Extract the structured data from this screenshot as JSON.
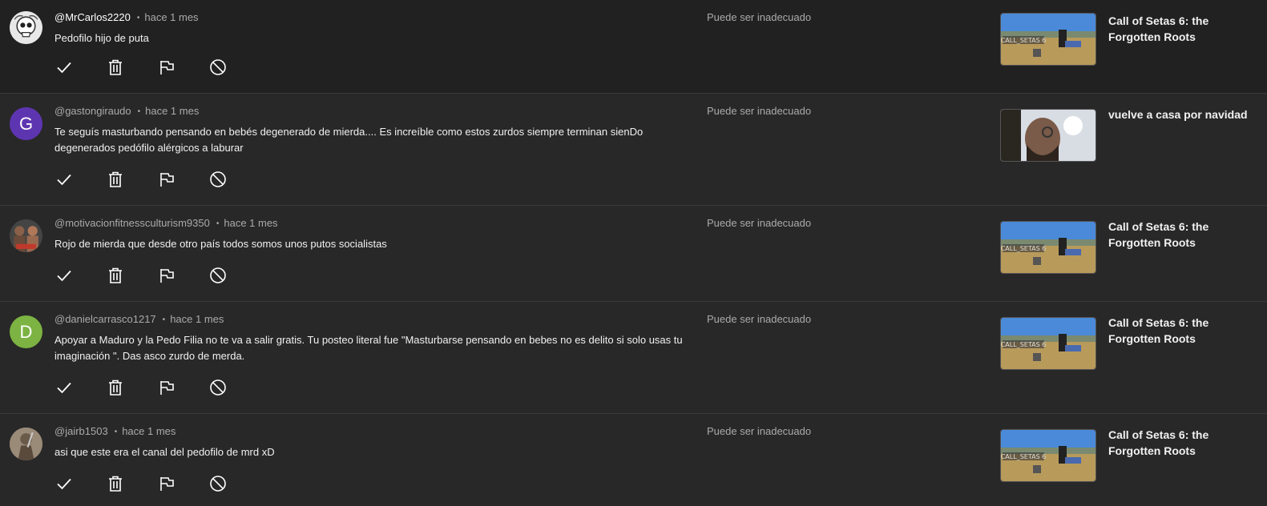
{
  "status_label": "Puede ser inadecuado",
  "separator": "•",
  "colors": {
    "background": "#282828",
    "highlight_row": "#212121",
    "avatar_g": "#5e35b1",
    "avatar_d": "#7cb342"
  },
  "actions": [
    {
      "name": "approve",
      "icon": "check-icon"
    },
    {
      "name": "delete",
      "icon": "trash-icon"
    },
    {
      "name": "report",
      "icon": "flag-icon"
    },
    {
      "name": "hide-user",
      "icon": "block-icon"
    }
  ],
  "comments": [
    {
      "author": "@MrCarlos2220",
      "time": "hace 1 mes",
      "text": "Pedofilo hijo de puta",
      "avatar": {
        "type": "image",
        "icon": "skull-avatar"
      },
      "video_title": "Call of Setas 6: the Forgotten Roots"
    },
    {
      "author": "@gastongiraudo",
      "time": "hace 1 mes",
      "text": "Te seguís masturbando pensando en bebés degenerado de mierda.... Es increíble como estos zurdos siempre terminan sienDo degenerados pedófilo alérgicos a laburar",
      "avatar": {
        "type": "letter",
        "letter": "G"
      },
      "video_title": "vuelve a casa por navidad"
    },
    {
      "author": "@motivacionfitnessculturism9350",
      "time": "hace 1 mes",
      "text": "Rojo de mierda que desde otro país todos somos unos putos socialistas",
      "avatar": {
        "type": "image",
        "icon": "fighters-avatar"
      },
      "video_title": "Call of Setas 6: the Forgotten Roots"
    },
    {
      "author": "@danielcarrasco1217",
      "time": "hace 1 mes",
      "text": "Apoyar a Maduro y la Pedo Filia no te va a salir gratis. Tu posteo literal fue \"Masturbarse pensando en bebes no es delito si solo usas tu imaginación \". Das asco zurdo de merda.",
      "avatar": {
        "type": "letter",
        "letter": "D"
      },
      "video_title": "Call of Setas 6: the Forgotten Roots"
    },
    {
      "author": "@jairb1503",
      "time": "hace 1 mes",
      "text": "asi que este era el canal del pedofilo de mrd xD",
      "avatar": {
        "type": "image",
        "icon": "statue-avatar"
      },
      "video_title": "Call of Setas 6: the Forgotten Roots"
    }
  ]
}
